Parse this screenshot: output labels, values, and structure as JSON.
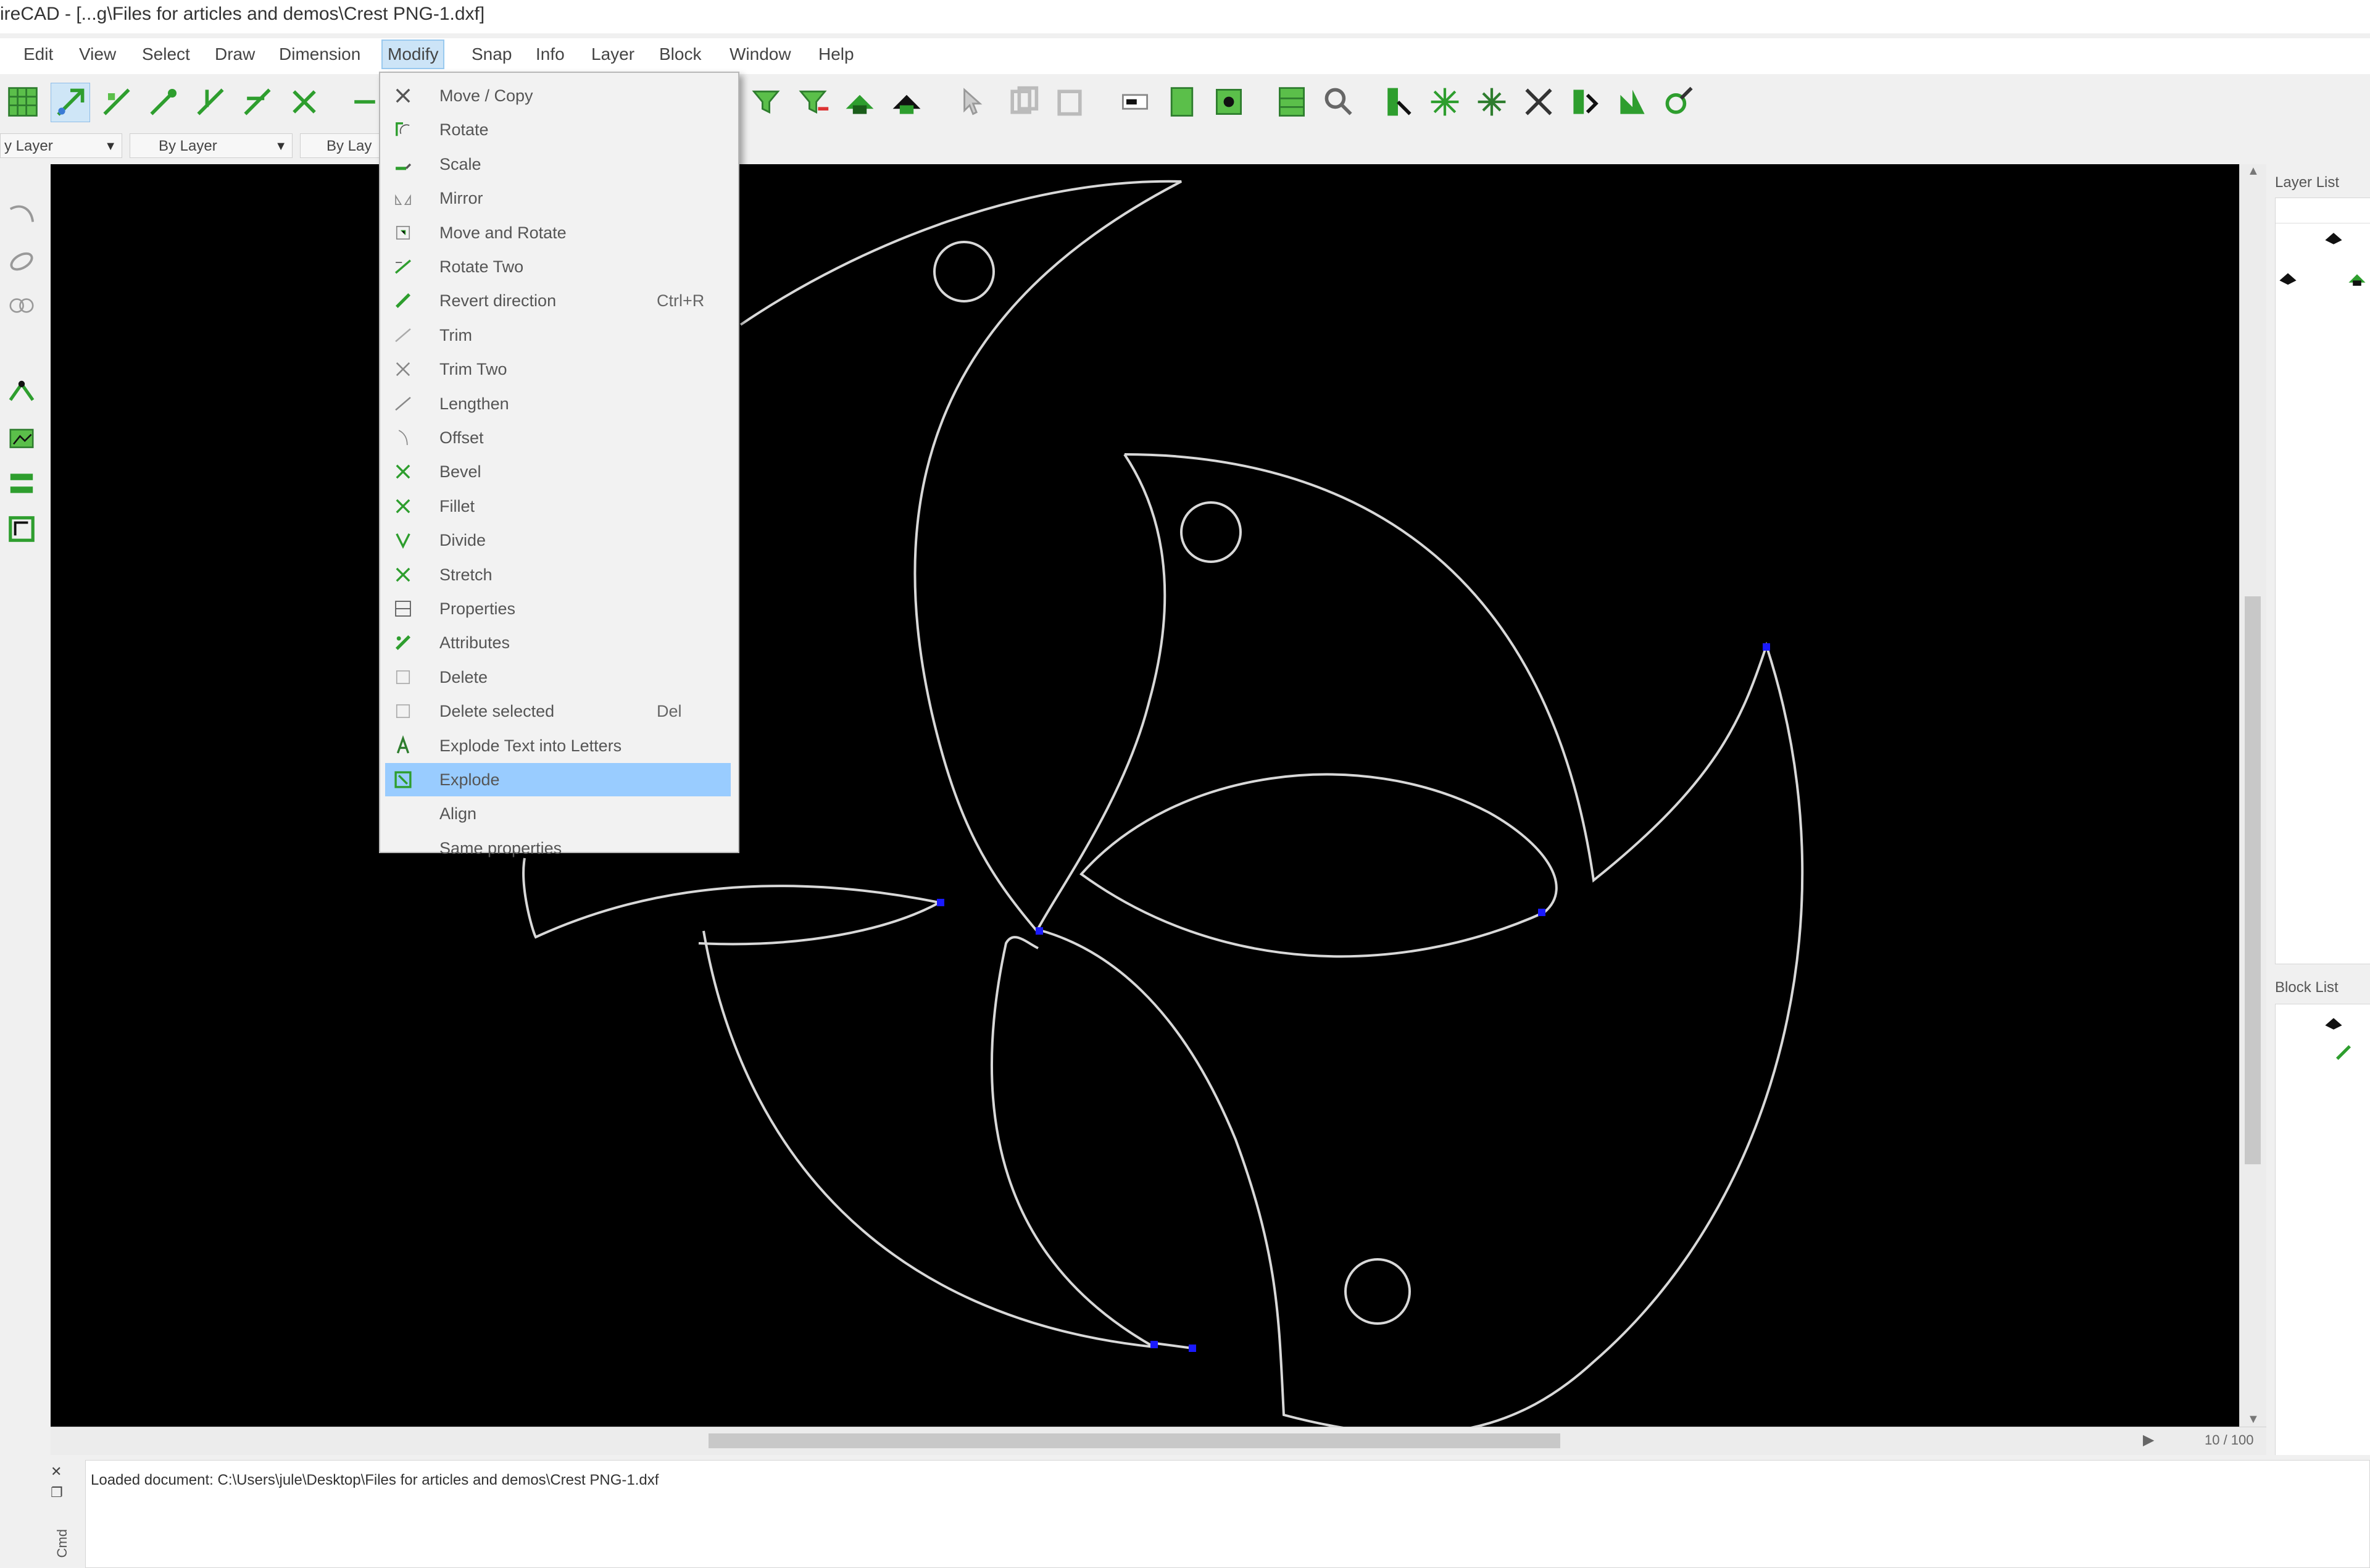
{
  "window": {
    "title": "ireCAD - [...g\\Files for articles and demos\\Crest PNG-1.dxf]"
  },
  "menubar": {
    "items": [
      {
        "label": "Edit"
      },
      {
        "label": "View"
      },
      {
        "label": "Select"
      },
      {
        "label": "Draw"
      },
      {
        "label": "Dimension"
      },
      {
        "label": "Modify"
      },
      {
        "label": "Snap"
      },
      {
        "label": "Info"
      },
      {
        "label": "Layer"
      },
      {
        "label": "Block"
      },
      {
        "label": "Window"
      },
      {
        "label": "Help"
      }
    ],
    "active": "Modify"
  },
  "modify_menu": {
    "items": [
      {
        "label": "Move / Copy",
        "icon": "move-copy-icon",
        "shortcut": ""
      },
      {
        "label": "Rotate",
        "icon": "rotate-icon",
        "shortcut": ""
      },
      {
        "label": "Scale",
        "icon": "scale-icon",
        "shortcut": ""
      },
      {
        "label": "Mirror",
        "icon": "mirror-icon",
        "shortcut": ""
      },
      {
        "label": "Move and Rotate",
        "icon": "move-rotate-icon",
        "shortcut": ""
      },
      {
        "label": "Rotate Two",
        "icon": "rotate-two-icon",
        "shortcut": ""
      },
      {
        "label": "Revert direction",
        "icon": "revert-direction-icon",
        "shortcut": "Ctrl+R"
      },
      {
        "label": "Trim",
        "icon": "trim-icon",
        "shortcut": ""
      },
      {
        "label": "Trim Two",
        "icon": "trim-two-icon",
        "shortcut": ""
      },
      {
        "label": "Lengthen",
        "icon": "lengthen-icon",
        "shortcut": ""
      },
      {
        "label": "Offset",
        "icon": "offset-icon",
        "shortcut": ""
      },
      {
        "label": "Bevel",
        "icon": "bevel-icon",
        "shortcut": ""
      },
      {
        "label": "Fillet",
        "icon": "fillet-icon",
        "shortcut": ""
      },
      {
        "label": "Divide",
        "icon": "divide-icon",
        "shortcut": ""
      },
      {
        "label": "Stretch",
        "icon": "stretch-icon",
        "shortcut": ""
      },
      {
        "label": "Properties",
        "icon": "properties-icon",
        "shortcut": ""
      },
      {
        "label": "Attributes",
        "icon": "attributes-icon",
        "shortcut": ""
      },
      {
        "label": "Delete",
        "icon": "delete-icon",
        "shortcut": ""
      },
      {
        "label": "Delete selected",
        "icon": "delete-selected-icon",
        "shortcut": "Del"
      },
      {
        "label": "Explode Text into Letters",
        "icon": "explode-text-icon",
        "shortcut": ""
      },
      {
        "label": "Explode",
        "icon": "explode-icon",
        "shortcut": "",
        "highlighted": true
      },
      {
        "label": "Align",
        "icon": "",
        "shortcut": ""
      },
      {
        "label": "Same properties",
        "icon": "",
        "shortcut": ""
      }
    ]
  },
  "propbar": {
    "layer_combo": "y Layer",
    "linetype_combo": "By Layer",
    "width_combo": "By Lay"
  },
  "right_dock": {
    "layer_list_title": "Layer List",
    "block_list_title": "Block List"
  },
  "status": {
    "zoom_readout": "10 / 100"
  },
  "command_line": {
    "message": "Loaded document: C:\\Users\\jule\\Desktop\\Files for articles and demos\\Crest PNG-1.dxf",
    "side_label": "Cmd"
  },
  "colors": {
    "canvas_bg": "#000000",
    "entity_stroke": "#d8d8d8",
    "endpoint_marker": "#1a1aff",
    "menu_highlight": "#99ccff",
    "icon_green": "#2e9e2e"
  }
}
